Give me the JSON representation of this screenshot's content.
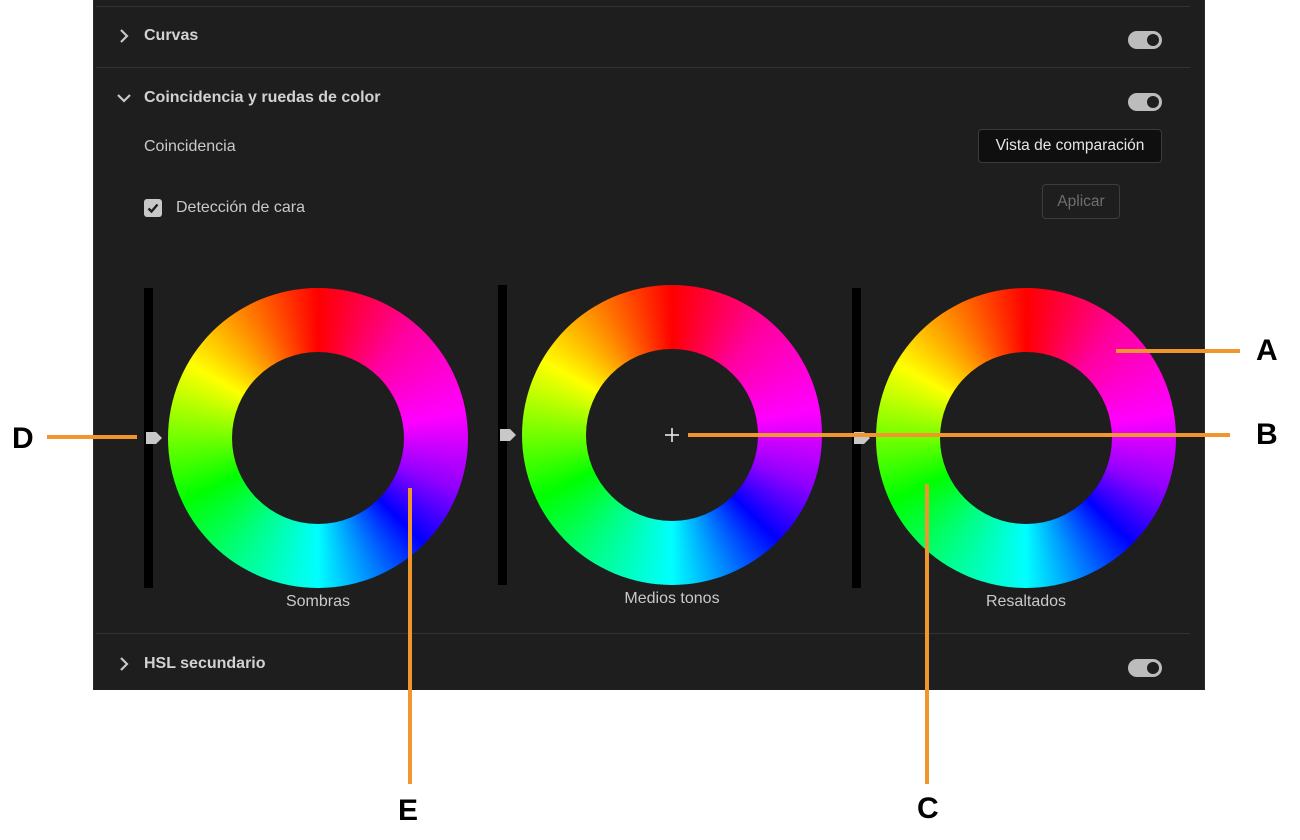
{
  "sections": {
    "curves": {
      "label": "Curvas",
      "expanded": false,
      "enabled": true
    },
    "match_wheels": {
      "label": "Coincidencia y ruedas de color",
      "expanded": true,
      "enabled": true
    },
    "secondary_hsl": {
      "label": "HSL secundario",
      "expanded": false,
      "enabled": true
    }
  },
  "match": {
    "label": "Coincidencia",
    "compare_button": "Vista de comparación",
    "face_detection": {
      "label": "Detección de cara",
      "checked": true
    },
    "apply_button": "Aplicar"
  },
  "wheels": [
    {
      "id": "shadows",
      "label": "Sombras"
    },
    {
      "id": "midtones",
      "label": "Medios tonos"
    },
    {
      "id": "highlights",
      "label": "Resaltados"
    }
  ],
  "callouts": [
    "A",
    "B",
    "C",
    "D",
    "E"
  ],
  "colors": {
    "panel_bg": "#1e1e1e",
    "callout_line": "#f0962d",
    "toggle_on": "#bcbcbc"
  }
}
